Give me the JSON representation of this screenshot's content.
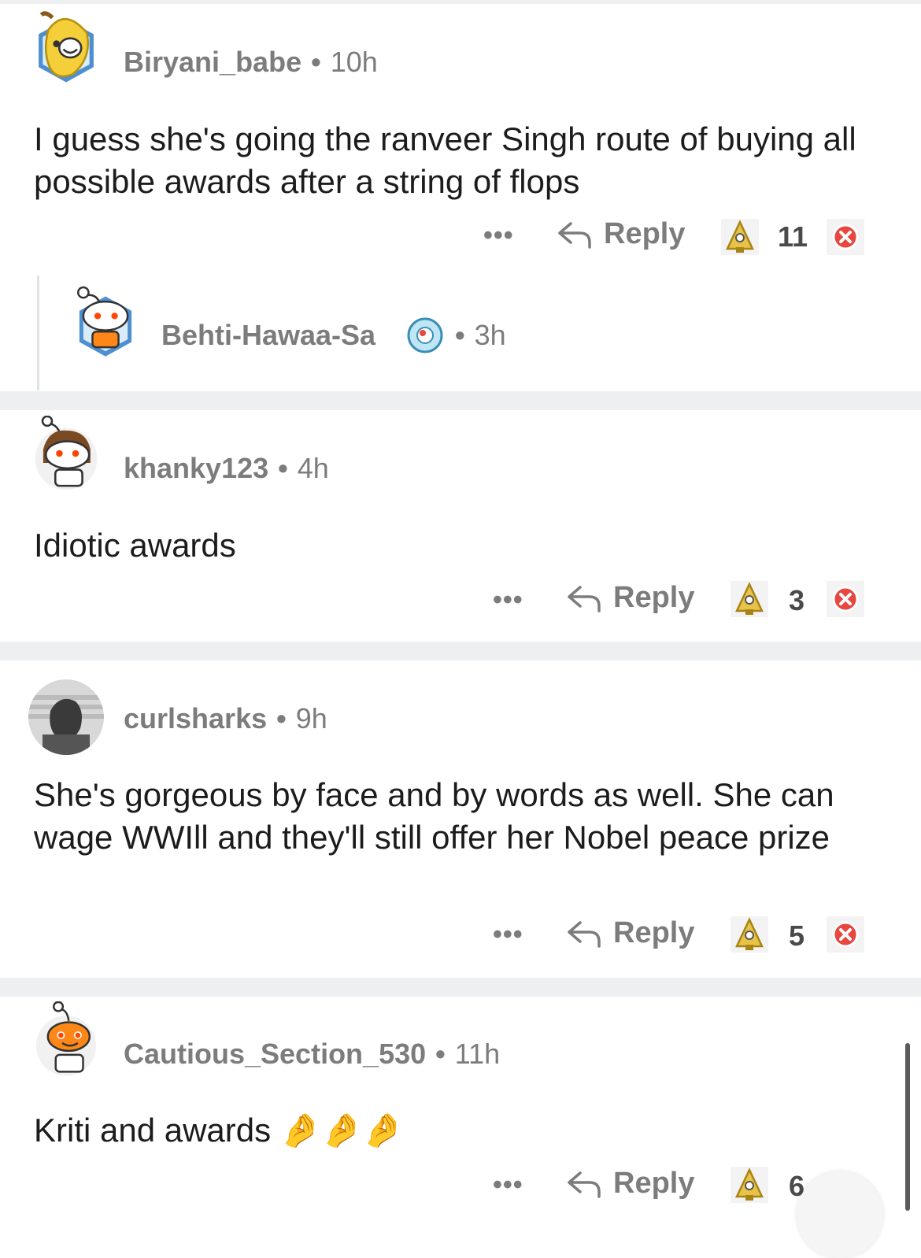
{
  "comments": [
    {
      "username": "Biryani_babe",
      "time": "10h",
      "text": "I guess she's going the ranveer Singh route of buying all possible awards after a string of flops",
      "more": "•••",
      "reply_label": "Reply",
      "score": "11"
    },
    {
      "username": "Behti-Hawaa-Sa",
      "time": "3h"
    },
    {
      "username": "khanky123",
      "time": "4h",
      "text": "Idiotic awards",
      "more": "•••",
      "reply_label": "Reply",
      "score": "3"
    },
    {
      "username": "curlsharks",
      "time": "9h",
      "text": "She's gorgeous by face and by words as well. She can wage WWIll and they'll still offer her Nobel peace prize",
      "more": "•••",
      "reply_label": "Reply",
      "score": "5"
    },
    {
      "username": "Cautious_Section_530",
      "time": "11h",
      "text": "Kriti and awards",
      "emoji": "🤌🤌🤌",
      "more": "•••",
      "reply_label": "Reply",
      "score": "6"
    }
  ],
  "separator_dot": "•",
  "colors": {
    "upvote_gold": "#e8c34a",
    "downvote_red": "#e8463e",
    "meta_gray": "#7c7c7c",
    "separator": "#edeff1"
  }
}
